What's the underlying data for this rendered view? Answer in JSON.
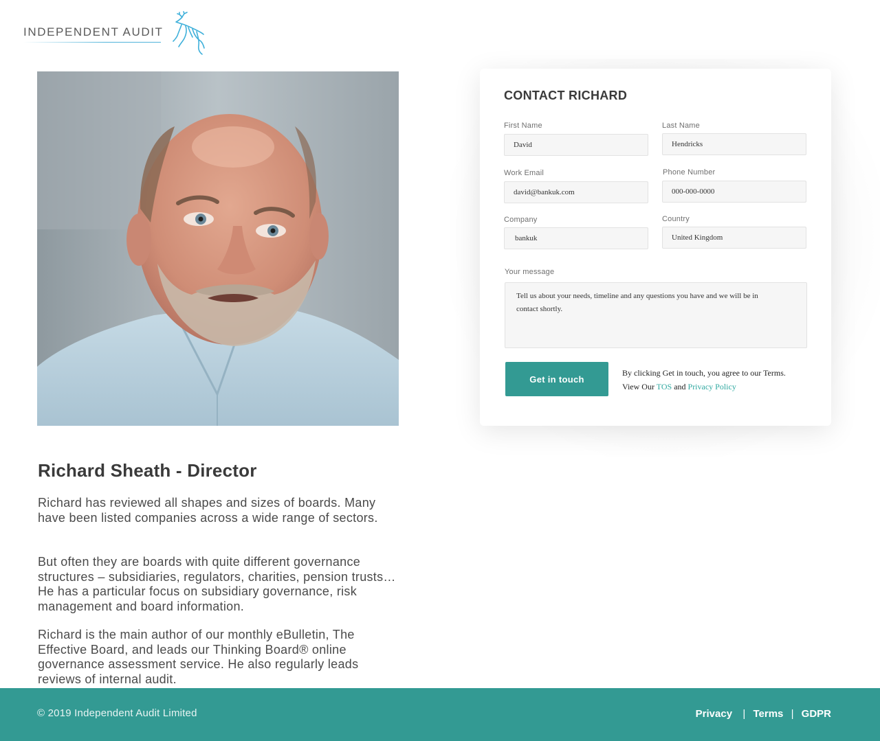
{
  "header": {
    "logo_text": "INDEPENDENT AUDIT",
    "logo_icon": "leaping-deer-icon"
  },
  "profile": {
    "photo_icon": "person-portrait",
    "name": "Richard Sheath - Director",
    "bio": [
      "Richard has reviewed all shapes and sizes of boards.  Many have been listed companies across a wide range of sectors.",
      "But often they are boards with quite different governance structures – subsidiaries, regulators, charities, pension trusts…  He has a particular focus on subsidiary governance, risk management and board information.",
      "Richard is the main author of our monthly eBulletin, The Effective Board, and leads our Thinking Board® online governance assessment service.  He also regularly leads reviews of internal audit."
    ]
  },
  "contact_form": {
    "title": "CONTACT RICHARD",
    "fields": {
      "first_name": {
        "label": "First Name",
        "value": "David"
      },
      "last_name": {
        "label": "Last Name",
        "value": "Hendricks"
      },
      "work_email": {
        "label": "Work Email",
        "value": "david@bankuk.com"
      },
      "phone": {
        "label": "Phone Number",
        "value": "000-000-0000"
      },
      "company": {
        "label": "Company",
        "value": "bankuk"
      },
      "country": {
        "label": "Country",
        "value": "United Kingdom"
      }
    },
    "message": {
      "label": "Your message",
      "value": "Tell us about your needs, timeline and any questions you have and we will be in contact shortly."
    },
    "submit_label": "Get in touch",
    "terms_text": "By clicking Get in touch, you agree to our Terms.",
    "terms_view": "View Our",
    "tos_link": "TOS",
    "and_text": "and",
    "privacy_link": "Privacy Policy"
  },
  "footer": {
    "copyright": "© 2019 Independent Audit Limited",
    "links": [
      "Privacy",
      "Terms",
      "GDPR"
    ]
  },
  "colors": {
    "accent": "#339a93",
    "link": "#2fa8a0",
    "logo_blue": "#4fb3d9"
  }
}
